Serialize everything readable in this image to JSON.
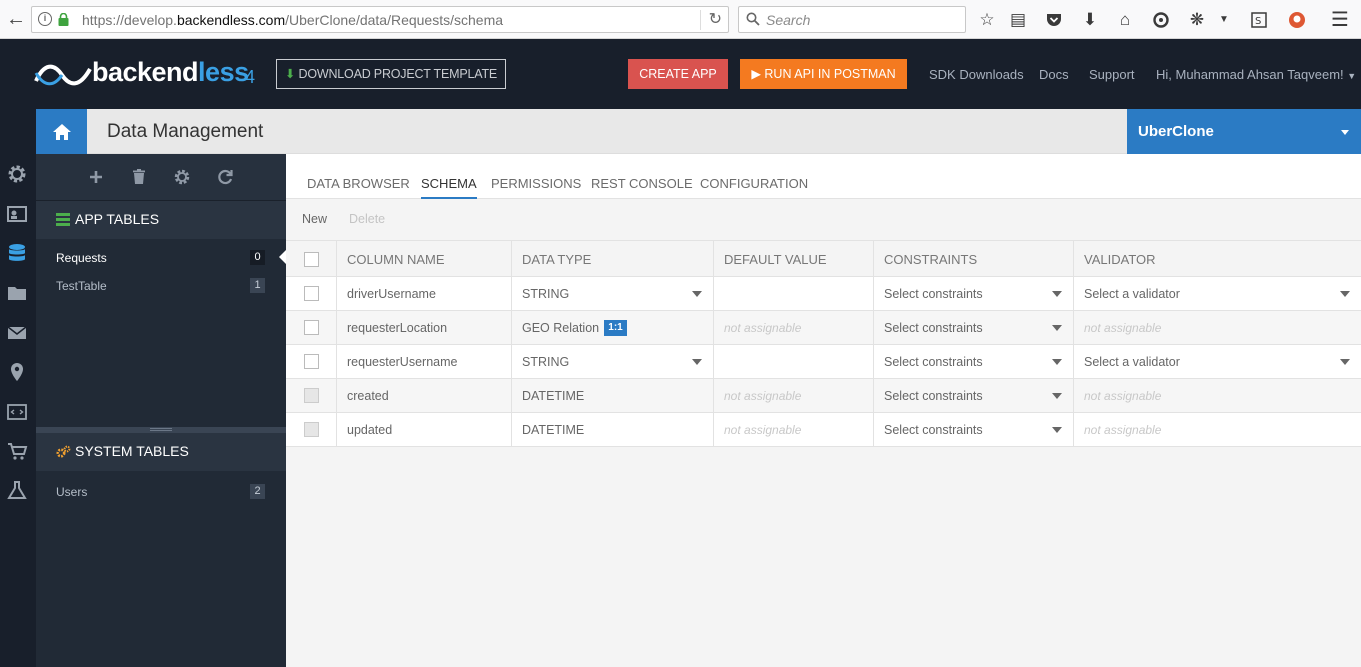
{
  "browser": {
    "url_prefix": "https://develop.",
    "url_domain": "backendless.com",
    "url_path": "/UberClone/data/Requests/schema",
    "search_placeholder": "Search"
  },
  "header": {
    "logo_text_a": "backend",
    "logo_text_b": "less",
    "logo_version": "4",
    "download_label": "DOWNLOAD PROJECT TEMPLATE",
    "create_app_label": "CREATE APP",
    "run_api_label": "RUN API IN POSTMAN",
    "links": [
      "SDK Downloads",
      "Docs",
      "Support"
    ],
    "user_greeting": "Hi, Muhammad Ahsan Taqveem!"
  },
  "titlebar": {
    "title": "Data Management",
    "app_name": "UberClone"
  },
  "sidebar": {
    "app_tables_heading": "APP TABLES",
    "app_tables": [
      {
        "name": "Requests",
        "count": "0",
        "active": true
      },
      {
        "name": "TestTable",
        "count": "1",
        "active": false
      }
    ],
    "system_tables_heading": "SYSTEM TABLES",
    "system_tables": [
      {
        "name": "Users",
        "count": "2"
      }
    ]
  },
  "tabs": [
    "DATA BROWSER",
    "SCHEMA",
    "PERMISSIONS",
    "REST CONSOLE",
    "CONFIGURATION"
  ],
  "active_tab": "SCHEMA",
  "actions": {
    "new_label": "New",
    "delete_label": "Delete"
  },
  "table": {
    "headers": [
      "COLUMN NAME",
      "DATA TYPE",
      "DEFAULT VALUE",
      "CONSTRAINTS",
      "VALIDATOR"
    ],
    "rows": [
      {
        "name": "driverUsername",
        "type": "STRING",
        "default": "",
        "constraints": "Select constraints",
        "validator": "Select a validator"
      },
      {
        "name": "requesterLocation",
        "type": "GEO Relation",
        "badge": "1:1",
        "default": "not assignable",
        "constraints": "Select constraints",
        "validator": "not assignable"
      },
      {
        "name": "requesterUsername",
        "type": "STRING",
        "default": "",
        "constraints": "Select constraints",
        "validator": "Select a validator"
      },
      {
        "name": "created",
        "type": "DATETIME",
        "default": "not assignable",
        "constraints": "Select constraints",
        "validator": "not assignable"
      },
      {
        "name": "updated",
        "type": "DATETIME",
        "default": "not assignable",
        "constraints": "Select constraints",
        "validator": "not assignable"
      }
    ]
  },
  "colors": {
    "dark_bg": "#181f2b",
    "sidebar_bg": "#212a36",
    "accent_blue": "#2b7bc4",
    "create_red": "#d9534f",
    "run_orange": "#f47a20"
  }
}
